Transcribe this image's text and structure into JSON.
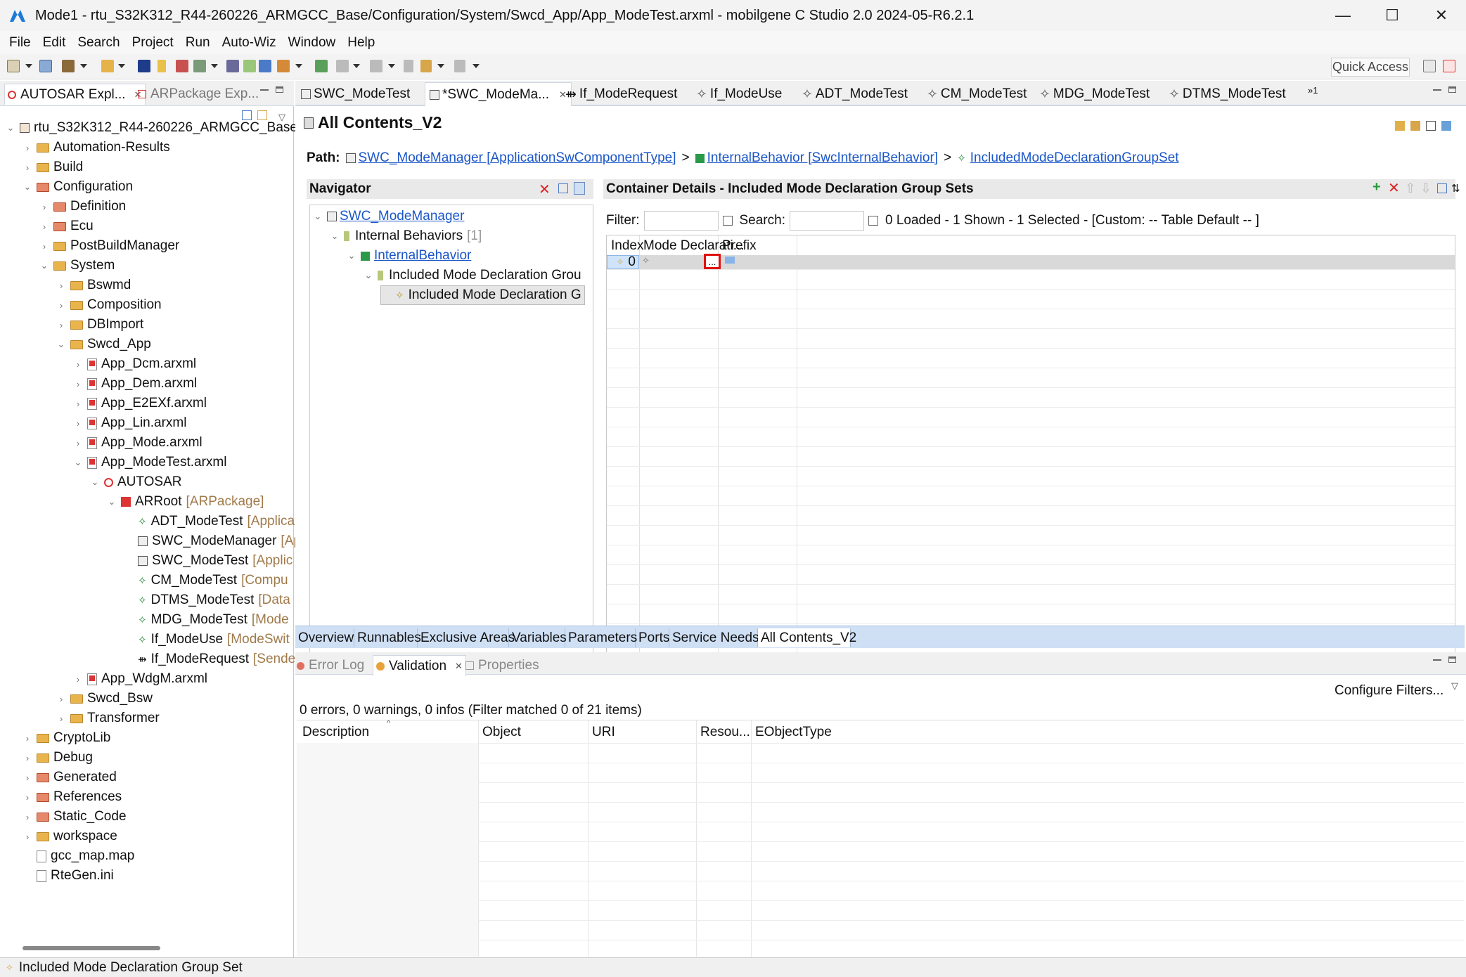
{
  "window": {
    "title": "Mode1 - rtu_S32K312_R44-260226_ARMGCC_Base/Configuration/System/Swcd_App/App_ModeTest.arxml - mobilgene C Studio 2.0 2024-05-R6.2.1",
    "minimize": "—",
    "maximize": "☐",
    "close": "✕"
  },
  "menu": [
    "File",
    "Edit",
    "Search",
    "Project",
    "Run",
    "Auto-Wiz",
    "Window",
    "Help"
  ],
  "toolbar": {
    "quick_access": "Quick Access"
  },
  "left_panel": {
    "tabs": [
      {
        "label": "AUTOSAR Expl..."
      },
      {
        "label": "ARPackage Exp..."
      }
    ],
    "tree": [
      {
        "label": "rtu_S32K312_R44-260226_ARMGCC_Base",
        "level": 0,
        "chev": "v",
        "icon": "project"
      },
      {
        "label": "Automation-Results",
        "level": 1,
        "chev": ">",
        "icon": "folder"
      },
      {
        "label": "Build",
        "level": 1,
        "chev": ">",
        "icon": "folder"
      },
      {
        "label": "Configuration",
        "level": 1,
        "chev": "v",
        "icon": "folder-red"
      },
      {
        "label": "Definition",
        "level": 2,
        "chev": ">",
        "icon": "folder-red"
      },
      {
        "label": "Ecu",
        "level": 2,
        "chev": ">",
        "icon": "folder-red"
      },
      {
        "label": "PostBuildManager",
        "level": 2,
        "chev": ">",
        "icon": "folder"
      },
      {
        "label": "System",
        "level": 2,
        "chev": "v",
        "icon": "folder"
      },
      {
        "label": "Bswmd",
        "level": 3,
        "chev": ">",
        "icon": "folder"
      },
      {
        "label": "Composition",
        "level": 3,
        "chev": ">",
        "icon": "folder"
      },
      {
        "label": "DBImport",
        "level": 3,
        "chev": ">",
        "icon": "folder"
      },
      {
        "label": "Swcd_App",
        "level": 3,
        "chev": "v",
        "icon": "folder"
      },
      {
        "label": "App_Dcm.arxml",
        "level": 4,
        "chev": ">",
        "icon": "file-red"
      },
      {
        "label": "App_Dem.arxml",
        "level": 4,
        "chev": ">",
        "icon": "file-red"
      },
      {
        "label": "App_E2EXf.arxml",
        "level": 4,
        "chev": ">",
        "icon": "file-red"
      },
      {
        "label": "App_Lin.arxml",
        "level": 4,
        "chev": ">",
        "icon": "file-red"
      },
      {
        "label": "App_Mode.arxml",
        "level": 4,
        "chev": ">",
        "icon": "file-red"
      },
      {
        "label": "App_ModeTest.arxml",
        "level": 4,
        "chev": "v",
        "icon": "file-red"
      },
      {
        "label": "AUTOSAR",
        "level": 5,
        "chev": "v",
        "icon": "autosar"
      },
      {
        "label": "ARRoot",
        "suffix": "[ARPackage]",
        "level": 6,
        "chev": "v",
        "icon": "package"
      },
      {
        "label": "ADT_ModeTest",
        "suffix": "[Applica",
        "level": 7,
        "chev": "",
        "icon": "diamond"
      },
      {
        "label": "SWC_ModeManager",
        "suffix": "[Ap",
        "level": 7,
        "chev": "",
        "icon": "component"
      },
      {
        "label": "SWC_ModeTest",
        "suffix": "[Applic",
        "level": 7,
        "chev": "",
        "icon": "component"
      },
      {
        "label": "CM_ModeTest",
        "suffix": "[Compu",
        "level": 7,
        "chev": "",
        "icon": "diamond"
      },
      {
        "label": "DTMS_ModeTest",
        "suffix": "[Data",
        "level": 7,
        "chev": "",
        "icon": "diamond"
      },
      {
        "label": "MDG_ModeTest",
        "suffix": "[Mode",
        "level": 7,
        "chev": "",
        "icon": "diamond"
      },
      {
        "label": "If_ModeUse",
        "suffix": "[ModeSwit",
        "level": 7,
        "chev": "",
        "icon": "diamond"
      },
      {
        "label": "If_ModeRequest",
        "suffix": "[Sende",
        "level": 7,
        "chev": "",
        "icon": "arrow"
      },
      {
        "label": "App_WdgM.arxml",
        "level": 4,
        "chev": ">",
        "icon": "file-red"
      },
      {
        "label": "Swcd_Bsw",
        "level": 3,
        "chev": ">",
        "icon": "folder"
      },
      {
        "label": "Transformer",
        "level": 3,
        "chev": ">",
        "icon": "folder"
      },
      {
        "label": "CryptoLib",
        "level": 1,
        "chev": ">",
        "icon": "folder"
      },
      {
        "label": "Debug",
        "level": 1,
        "chev": ">",
        "icon": "folder"
      },
      {
        "label": "Generated",
        "level": 1,
        "chev": ">",
        "icon": "folder-red"
      },
      {
        "label": "References",
        "level": 1,
        "chev": ">",
        "icon": "folder-red"
      },
      {
        "label": "Static_Code",
        "level": 1,
        "chev": ">",
        "icon": "folder-red"
      },
      {
        "label": "workspace",
        "level": 1,
        "chev": ">",
        "icon": "folder"
      },
      {
        "label": "gcc_map.map",
        "level": 1,
        "chev": "",
        "icon": "file"
      },
      {
        "label": "RteGen.ini",
        "level": 1,
        "chev": "",
        "icon": "file"
      }
    ]
  },
  "editor": {
    "tabs": [
      {
        "label": "SWC_ModeTest",
        "active": false
      },
      {
        "label": "*SWC_ModeMa...",
        "active": true
      },
      {
        "label": "If_ModeRequest",
        "active": false
      },
      {
        "label": "If_ModeUse",
        "active": false
      },
      {
        "label": "ADT_ModeTest",
        "active": false
      },
      {
        "label": "CM_ModeTest",
        "active": false
      },
      {
        "label": "MDG_ModeTest",
        "active": false
      },
      {
        "label": "DTMS_ModeTest",
        "active": false
      }
    ],
    "overflow": "»1",
    "title": "All Contents_V2",
    "path_label": "Path:",
    "path": [
      {
        "text": "SWC_ModeManager [ApplicationSwComponentType]"
      },
      {
        "text": "InternalBehavior [SwcInternalBehavior]"
      },
      {
        "text": "IncludedModeDeclarationGroupSet"
      }
    ],
    "path_sep": ">",
    "navigator": {
      "title": "Navigator",
      "items": [
        {
          "label": "SWC_ModeManager",
          "level": 0,
          "chev": "v",
          "link": true
        },
        {
          "label": "Internal Behaviors",
          "count": "[1]",
          "level": 1,
          "chev": "v",
          "link": false
        },
        {
          "label": "InternalBehavior",
          "level": 2,
          "chev": "v",
          "link": true
        },
        {
          "label": "Included Mode Declaration Grou",
          "level": 3,
          "chev": "v",
          "link": false
        },
        {
          "label": "Included Mode Declaration G",
          "level": 4,
          "chev": "",
          "link": false,
          "selected": true
        }
      ]
    },
    "details": {
      "title": "Container Details - Included Mode Declaration Group Sets",
      "filter_label": "Filter:",
      "search_label": "Search:",
      "status": "0 Loaded - 1 Shown - 1 Selected -  [Custom: -- Table Default -- ]",
      "columns": [
        "Index",
        "Mode Declarati...",
        "Prefix"
      ],
      "rows": [
        {
          "index": "0",
          "button": "..."
        }
      ]
    },
    "bottom_tabs": [
      {
        "label": "Overview"
      },
      {
        "label": "Runnables"
      },
      {
        "label": "Exclusive Areas"
      },
      {
        "label": "Variables"
      },
      {
        "label": "Parameters"
      },
      {
        "label": "Ports"
      },
      {
        "label": "Service Needs"
      },
      {
        "label": "All Contents_V2",
        "active": true
      }
    ]
  },
  "lower": {
    "tabs": [
      {
        "label": "Error Log"
      },
      {
        "label": "Validation"
      },
      {
        "label": "Properties"
      }
    ],
    "configure": "Configure Filters...",
    "summary": "0 errors, 0 warnings, 0 infos (Filter matched 0 of 21 items)",
    "columns": [
      "Description",
      "Object",
      "URI",
      "Resou...",
      "EObjectType"
    ]
  },
  "status": {
    "text": "Included Mode Declaration Group Set"
  },
  "colors": {
    "link": "#1a56c8",
    "tab_strip": "#cfe0f5",
    "highlight": "#e01010"
  }
}
